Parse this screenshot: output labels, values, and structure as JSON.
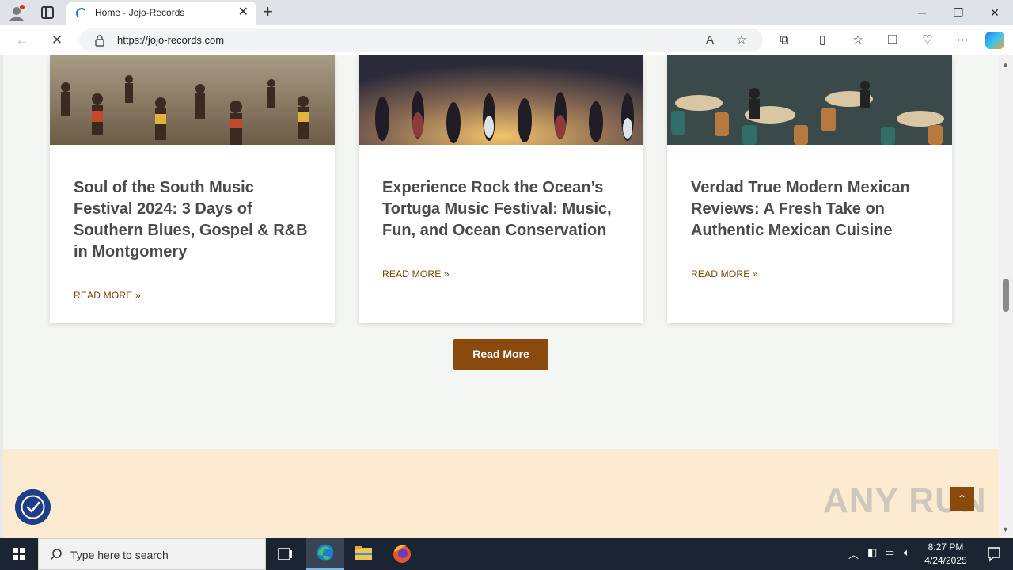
{
  "browser": {
    "tab_title": "Home - Jojo-Records",
    "tab_close": "✕",
    "new_tab": "+",
    "url": "https://jojo-records.com",
    "minimize": "─",
    "restore": "❐",
    "close": "✕"
  },
  "posts": [
    {
      "title": "Soul of the South Music Festival 2024: 3 Days of Southern Blues, Gospel & R&B in Montgomery",
      "link_label": "READ MORE »"
    },
    {
      "title": "Experience Rock the Ocean’s Tortuga Music Festival: Music, Fun, and Ocean Conservation",
      "link_label": "READ MORE »"
    },
    {
      "title": "Verdad True Modern Mexican Reviews: A Fresh Take on Authentic Mexican Cuisine",
      "link_label": "READ MORE »"
    }
  ],
  "read_more_button": "Read More",
  "back_to_top": "⌃",
  "watermark": "ANY RUN",
  "taskbar": {
    "search_placeholder": "Type here to search",
    "time": "8:27 PM",
    "date": "4/24/2025"
  },
  "colors": {
    "accent_brown": "#8a4a0e",
    "link_brown": "#7a4400",
    "footer_band": "#fcebd0",
    "page_bg": "#f4f6f3"
  }
}
